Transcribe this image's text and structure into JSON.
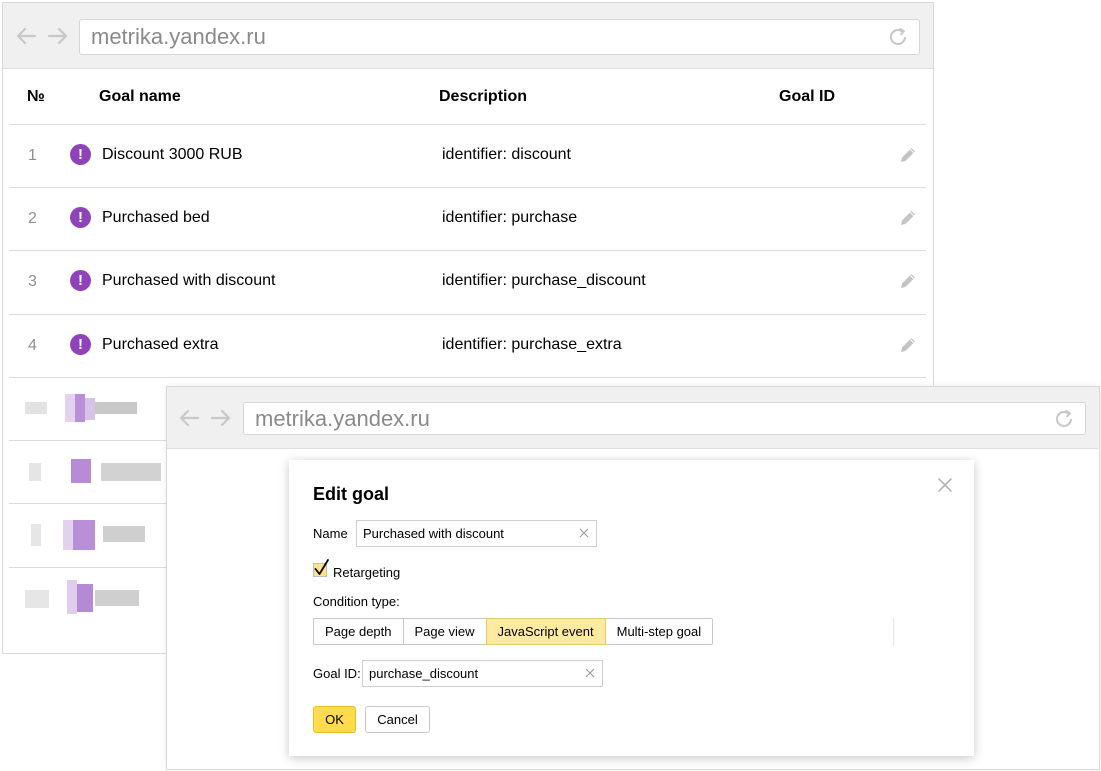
{
  "back_window": {
    "address_bar": {
      "url": "metrika.yandex.ru"
    },
    "table": {
      "headers": {
        "num": "№",
        "goal_name": "Goal name",
        "description": "Description",
        "goal_id": "Goal ID"
      },
      "rows": [
        {
          "num": "1",
          "name": "Discount 3000 RUB",
          "description": "identifier: discount",
          "icon": "exclamation-icon"
        },
        {
          "num": "2",
          "name": "Purchased bed",
          "description": "identifier: purchase",
          "icon": "exclamation-icon"
        },
        {
          "num": "3",
          "name": "Purchased with discount",
          "description": "identifier: purchase_discount",
          "icon": "exclamation-icon"
        },
        {
          "num": "4",
          "name": "Purchased extra",
          "description": "identifier: purchase_extra",
          "icon": "exclamation-icon"
        }
      ],
      "icon_glyph": "!"
    }
  },
  "front_window": {
    "address_bar": {
      "url": "metrika.yandex.ru"
    }
  },
  "dialog": {
    "title": "Edit goal",
    "name_label": "Name",
    "name_value": "Purchased with discount",
    "retargeting_label": "Retargeting",
    "retargeting_checked": true,
    "condition_type_label": "Condition type:",
    "condition_types": [
      "Page depth",
      "Page view",
      "JavaScript event",
      "Multi-step goal"
    ],
    "selected_condition_type": "JavaScript event",
    "goal_id_label": "Goal ID:",
    "goal_id_value": "purchase_discount",
    "ok_label": "OK",
    "cancel_label": "Cancel"
  },
  "colors": {
    "goal_icon": "#8e44b8",
    "accent_yellow": "#ffdb4d",
    "selected_segment": "#ffeba0"
  }
}
